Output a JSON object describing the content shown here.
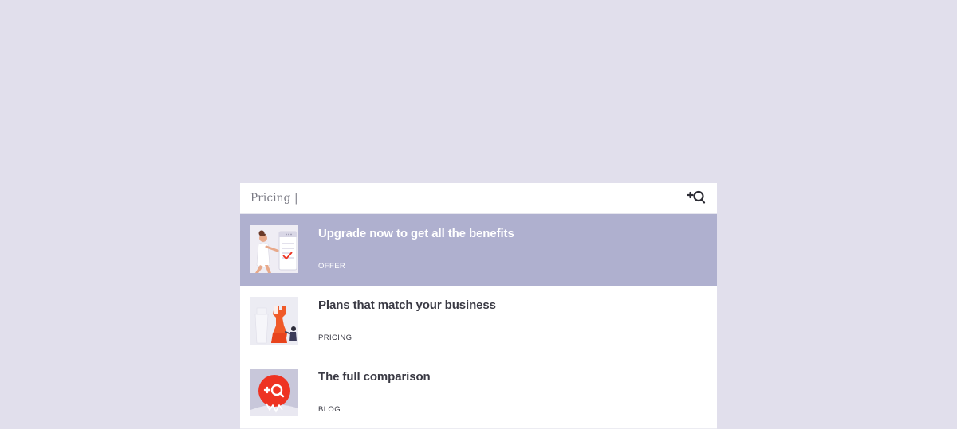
{
  "search": {
    "query": "Pricing |",
    "icon": "add-search-icon"
  },
  "results": [
    {
      "title": "Upgrade now to get all the benefits",
      "tag": "OFFER",
      "thumb_icon": "woman-pointing-illustration",
      "active": true
    },
    {
      "title": "Plans that match your business",
      "tag": "PRICING",
      "thumb_icon": "chess-rook-illustration",
      "active": false
    },
    {
      "title": "The full comparison",
      "tag": "BLOG",
      "thumb_icon": "red-search-badge-illustration",
      "active": false
    }
  ],
  "colors": {
    "background": "#e1dfec",
    "active_row": "#afb0cf",
    "accent_red": "#ee3322",
    "accent_orange": "#f05a28",
    "text_dark": "#3a3a44"
  }
}
